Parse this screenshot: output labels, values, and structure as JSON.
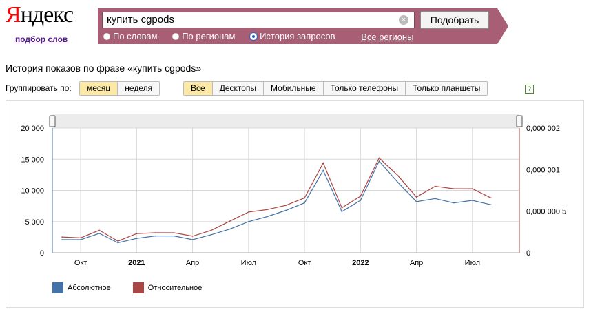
{
  "header": {
    "logo_first": "Я",
    "logo_rest": "ндекс",
    "logo_sub": "подбор слов"
  },
  "search": {
    "query": "купить cgpods",
    "button": "Подобрать",
    "modes": [
      "По словам",
      "По регионам",
      "История запросов"
    ],
    "selected_mode": "История запросов",
    "regions": "Все регионы"
  },
  "page": {
    "title": "История показов по фразе «купить cgpods»",
    "group_label": "Группировать по:",
    "group_options": [
      "месяц",
      "неделя"
    ],
    "group_selected": "месяц",
    "device_options": [
      "Все",
      "Десктопы",
      "Мобильные",
      "Только телефоны",
      "Только планшеты"
    ],
    "device_selected": "Все",
    "help": "?"
  },
  "colors": {
    "absolute": "#4572a7",
    "relative": "#aa4643",
    "accent_bar": "#a85f75"
  },
  "chart_data": {
    "type": "line",
    "x_tick_labels": [
      "Окт",
      "2021",
      "Апр",
      "Июл",
      "Окт",
      "2022",
      "Апр",
      "Июл"
    ],
    "months": [
      "2020-09",
      "2020-10",
      "2020-11",
      "2020-12",
      "2021-01",
      "2021-02",
      "2021-03",
      "2021-04",
      "2021-05",
      "2021-06",
      "2021-07",
      "2021-08",
      "2021-09",
      "2021-10",
      "2021-11",
      "2021-12",
      "2022-01",
      "2022-02",
      "2022-03",
      "2022-04",
      "2022-05",
      "2022-06",
      "2022-07",
      "2022-08",
      "2022-09"
    ],
    "y_left_ticks": [
      "0",
      "5 000",
      "10 000",
      "15 000",
      "20 000"
    ],
    "y_left_lim": [
      0,
      20000
    ],
    "y_right_ticks": [
      "0",
      "0,000 000 5",
      "0,000 001",
      "0,000 002"
    ],
    "y_right_lim": [
      0,
      1.5e-06
    ],
    "series": [
      {
        "name": "Абсолютное",
        "axis": "left",
        "values": [
          2100,
          2100,
          3100,
          1600,
          2300,
          2700,
          2700,
          2100,
          2900,
          3800,
          5000,
          5800,
          6800,
          8000,
          13200,
          6600,
          8400,
          14700,
          11300,
          8200,
          8700,
          8000,
          8400,
          7700
        ]
      },
      {
        "name": "Относительное",
        "axis": "right",
        "values": [
          1.9e-07,
          1.8e-07,
          2.7e-07,
          1.4e-07,
          2.3e-07,
          2.4e-07,
          2.4e-07,
          2e-07,
          2.7e-07,
          3.8e-07,
          4.9e-07,
          5.2e-07,
          5.7e-07,
          6.6e-07,
          1.08e-06,
          5.4e-07,
          6.8e-07,
          1.14e-06,
          9.3e-07,
          6.7e-07,
          8e-07,
          7.7e-07,
          7.7e-07,
          6.6e-07
        ]
      }
    ],
    "grid": true,
    "legend_position": "bottom-left"
  }
}
